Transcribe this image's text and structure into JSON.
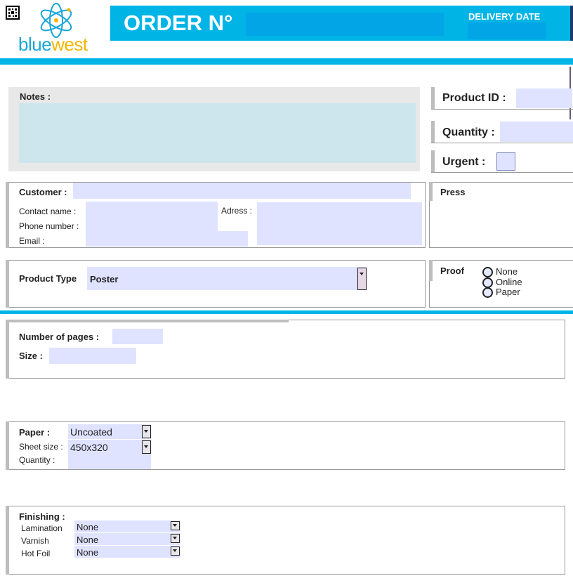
{
  "header": {
    "logo_text_blue": "blue",
    "logo_text_yellow": "west",
    "order_label": "ORDER N°",
    "order_number": "",
    "delivery_label": "DELIVERY DATE",
    "delivery_date": ""
  },
  "notes": {
    "label": "Notes :",
    "value": ""
  },
  "product_id": {
    "label": "Product  ID  :",
    "value": ""
  },
  "quantity": {
    "label": "Quantity  :",
    "value": ""
  },
  "urgent": {
    "label": "Urgent  :"
  },
  "customer": {
    "label": "Customer :",
    "contact_label": "Contact name :",
    "phone_label": "Phone number :",
    "email_label": "Email :",
    "address_label": "Adress :"
  },
  "press": {
    "label": "Press"
  },
  "product_type": {
    "label": "Product Type",
    "value": "Poster"
  },
  "proof": {
    "label": "Proof",
    "options": [
      "None",
      "Online",
      "Paper"
    ]
  },
  "pages": {
    "label": "Number of pages :",
    "value": ""
  },
  "size": {
    "label": "Size :",
    "value": ""
  },
  "paper": {
    "label": "Paper :",
    "value": "Uncoated",
    "sheet_label": "Sheet size :",
    "sheet_value": "450x320",
    "quantity_label": "Quantity :"
  },
  "finishing": {
    "label": "Finishing :",
    "lamination_label": "Lamination",
    "lamination_value": "None",
    "varnish_label": "Varnish",
    "varnish_value": "None",
    "hotfoil_label": "Hot Foil",
    "hotfoil_value": "None"
  },
  "colors": {
    "accent": "#00b4e6",
    "field": "#dfe3ff",
    "notes_bg": "#cde6ee",
    "logo_yellow": "#f2b600"
  }
}
